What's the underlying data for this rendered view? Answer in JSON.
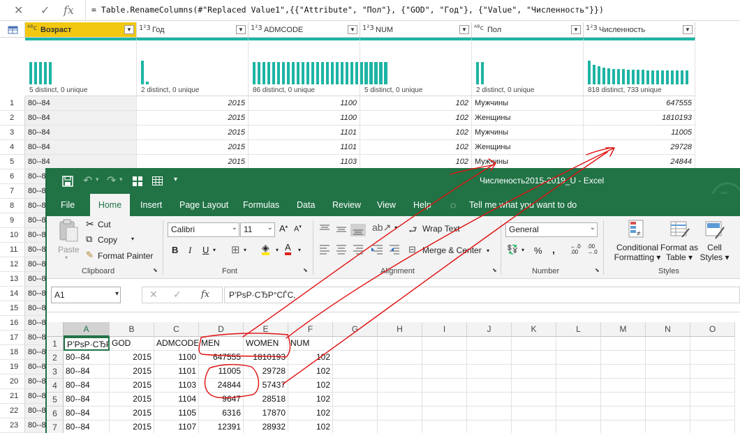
{
  "pq": {
    "formula": "= Table.RenameColumns(#\"Replaced Value1\",{{\"Attribute\", \"Пол\"}, {\"GOD\", \"Год\"}, {\"Value\", \"Численность\"}})",
    "cancel_icon": "✕",
    "confirm_icon": "✓",
    "fx_icon": "fx",
    "columns": [
      {
        "type": "ABC",
        "name": "Возраст",
        "stats": "5 distinct, 0 unique"
      },
      {
        "type": "123",
        "name": "Год",
        "stats": "2 distinct, 0 unique"
      },
      {
        "type": "123",
        "name": "ADMCODE",
        "stats": "86 distinct, 0 unique"
      },
      {
        "type": "123",
        "name": "NUM",
        "stats": "5 distinct, 0 unique"
      },
      {
        "type": "ABC",
        "name": "Пол",
        "stats": "2 distinct, 0 unique"
      },
      {
        "type": "123",
        "name": "Численность",
        "stats": "818 distinct, 733 unique"
      }
    ],
    "rows": [
      [
        "80--84",
        "2015",
        "1100",
        "102",
        "Мужчины",
        "647555"
      ],
      [
        "80--84",
        "2015",
        "1100",
        "102",
        "Женщины",
        "1810193"
      ],
      [
        "80--84",
        "2015",
        "1101",
        "102",
        "Мужчины",
        "11005"
      ],
      [
        "80--84",
        "2015",
        "1101",
        "102",
        "Женщины",
        "29728"
      ],
      [
        "80--84",
        "2015",
        "1103",
        "102",
        "Мужчины",
        "24844"
      ],
      [
        "80--84",
        "",
        "",
        "",
        "",
        ""
      ],
      [
        "80--84",
        "",
        "",
        "",
        "",
        ""
      ],
      [
        "80--84",
        "",
        "",
        "",
        "",
        ""
      ],
      [
        "80--84",
        "",
        "",
        "",
        "",
        ""
      ],
      [
        "80--84",
        "",
        "",
        "",
        "",
        ""
      ],
      [
        "80--84",
        "",
        "",
        "",
        "",
        ""
      ],
      [
        "80--84",
        "",
        "",
        "",
        "",
        ""
      ],
      [
        "80--84",
        "",
        "",
        "",
        "",
        ""
      ],
      [
        "80--84",
        "",
        "",
        "",
        "",
        ""
      ],
      [
        "80--84",
        "",
        "",
        "",
        "",
        ""
      ],
      [
        "80--84",
        "",
        "",
        "",
        "",
        ""
      ],
      [
        "80--84",
        "",
        "",
        "",
        "",
        ""
      ],
      [
        "80--84",
        "",
        "",
        "",
        "",
        ""
      ],
      [
        "80--84",
        "",
        "",
        "",
        "",
        ""
      ],
      [
        "80--84",
        "",
        "",
        "",
        "",
        ""
      ],
      [
        "80--84",
        "",
        "",
        "",
        "",
        ""
      ],
      [
        "80--84",
        "",
        "",
        "",
        "",
        ""
      ],
      [
        "80--84",
        "",
        "",
        "",
        "",
        ""
      ]
    ],
    "row_numbers": [
      "1",
      "2",
      "3",
      "4",
      "5",
      "6",
      "7",
      "8",
      "9",
      "10",
      "11",
      "12",
      "13",
      "14",
      "15",
      "16",
      "17",
      "18",
      "19",
      "20",
      "21",
      "22",
      "23"
    ]
  },
  "excel": {
    "title": "Численость2015-2019_U  -  Excel",
    "tabs": [
      "File",
      "Home",
      "Insert",
      "Page Layout",
      "Formulas",
      "Data",
      "Review",
      "View",
      "Help"
    ],
    "tell_me": "Tell me what you want to do",
    "ribbon": {
      "paste": "Paste",
      "cut": "Cut",
      "copy": "Copy",
      "format_painter": "Format Painter",
      "clipboard": "Clipboard",
      "font_name": "Calibri",
      "font_size": "11",
      "font_group": "Font",
      "bold": "B",
      "italic": "I",
      "underline": "U",
      "wrap_text": "Wrap Text",
      "merge_center": "Merge & Center",
      "alignment": "Alignment",
      "number_format": "General",
      "percent": "%",
      "comma": ",",
      "number": "Number",
      "conditional_formatting_1": "Conditional",
      "conditional_formatting_2": "Formatting",
      "format_table_1": "Format as",
      "format_table_2": "Table",
      "cell_styles_1": "Cell",
      "cell_styles_2": "Styles",
      "styles": "Styles"
    },
    "name_box": "A1",
    "formula_value": "Р’РѕР·СЂР°СЃС‚",
    "columns": [
      "A",
      "B",
      "C",
      "D",
      "E",
      "F",
      "G",
      "H",
      "I",
      "J",
      "K",
      "L",
      "M",
      "N",
      "O"
    ],
    "rows": [
      {
        "n": "1",
        "cells": [
          "Р’РѕР·СЂР°СЃС‚",
          "GOD",
          "ADMCODE",
          "MEN",
          "WOMEN",
          "NUM"
        ]
      },
      {
        "n": "2",
        "cells": [
          "80--84",
          "2015",
          "1100",
          "647555",
          "1810193",
          "102"
        ]
      },
      {
        "n": "3",
        "cells": [
          "80--84",
          "2015",
          "1101",
          "11005",
          "29728",
          "102"
        ]
      },
      {
        "n": "4",
        "cells": [
          "80--84",
          "2015",
          "1103",
          "24844",
          "57437",
          "102"
        ]
      },
      {
        "n": "5",
        "cells": [
          "80--84",
          "2015",
          "1104",
          "9647",
          "28518",
          "102"
        ]
      },
      {
        "n": "6",
        "cells": [
          "80--84",
          "2015",
          "1105",
          "6316",
          "17870",
          "102"
        ]
      },
      {
        "n": "7",
        "cells": [
          "80--84",
          "2015",
          "1107",
          "12391",
          "28932",
          "102"
        ]
      }
    ]
  },
  "annotation_color": "#e01010",
  "accent_color": "#217346",
  "profile_color": "#1db4a4"
}
